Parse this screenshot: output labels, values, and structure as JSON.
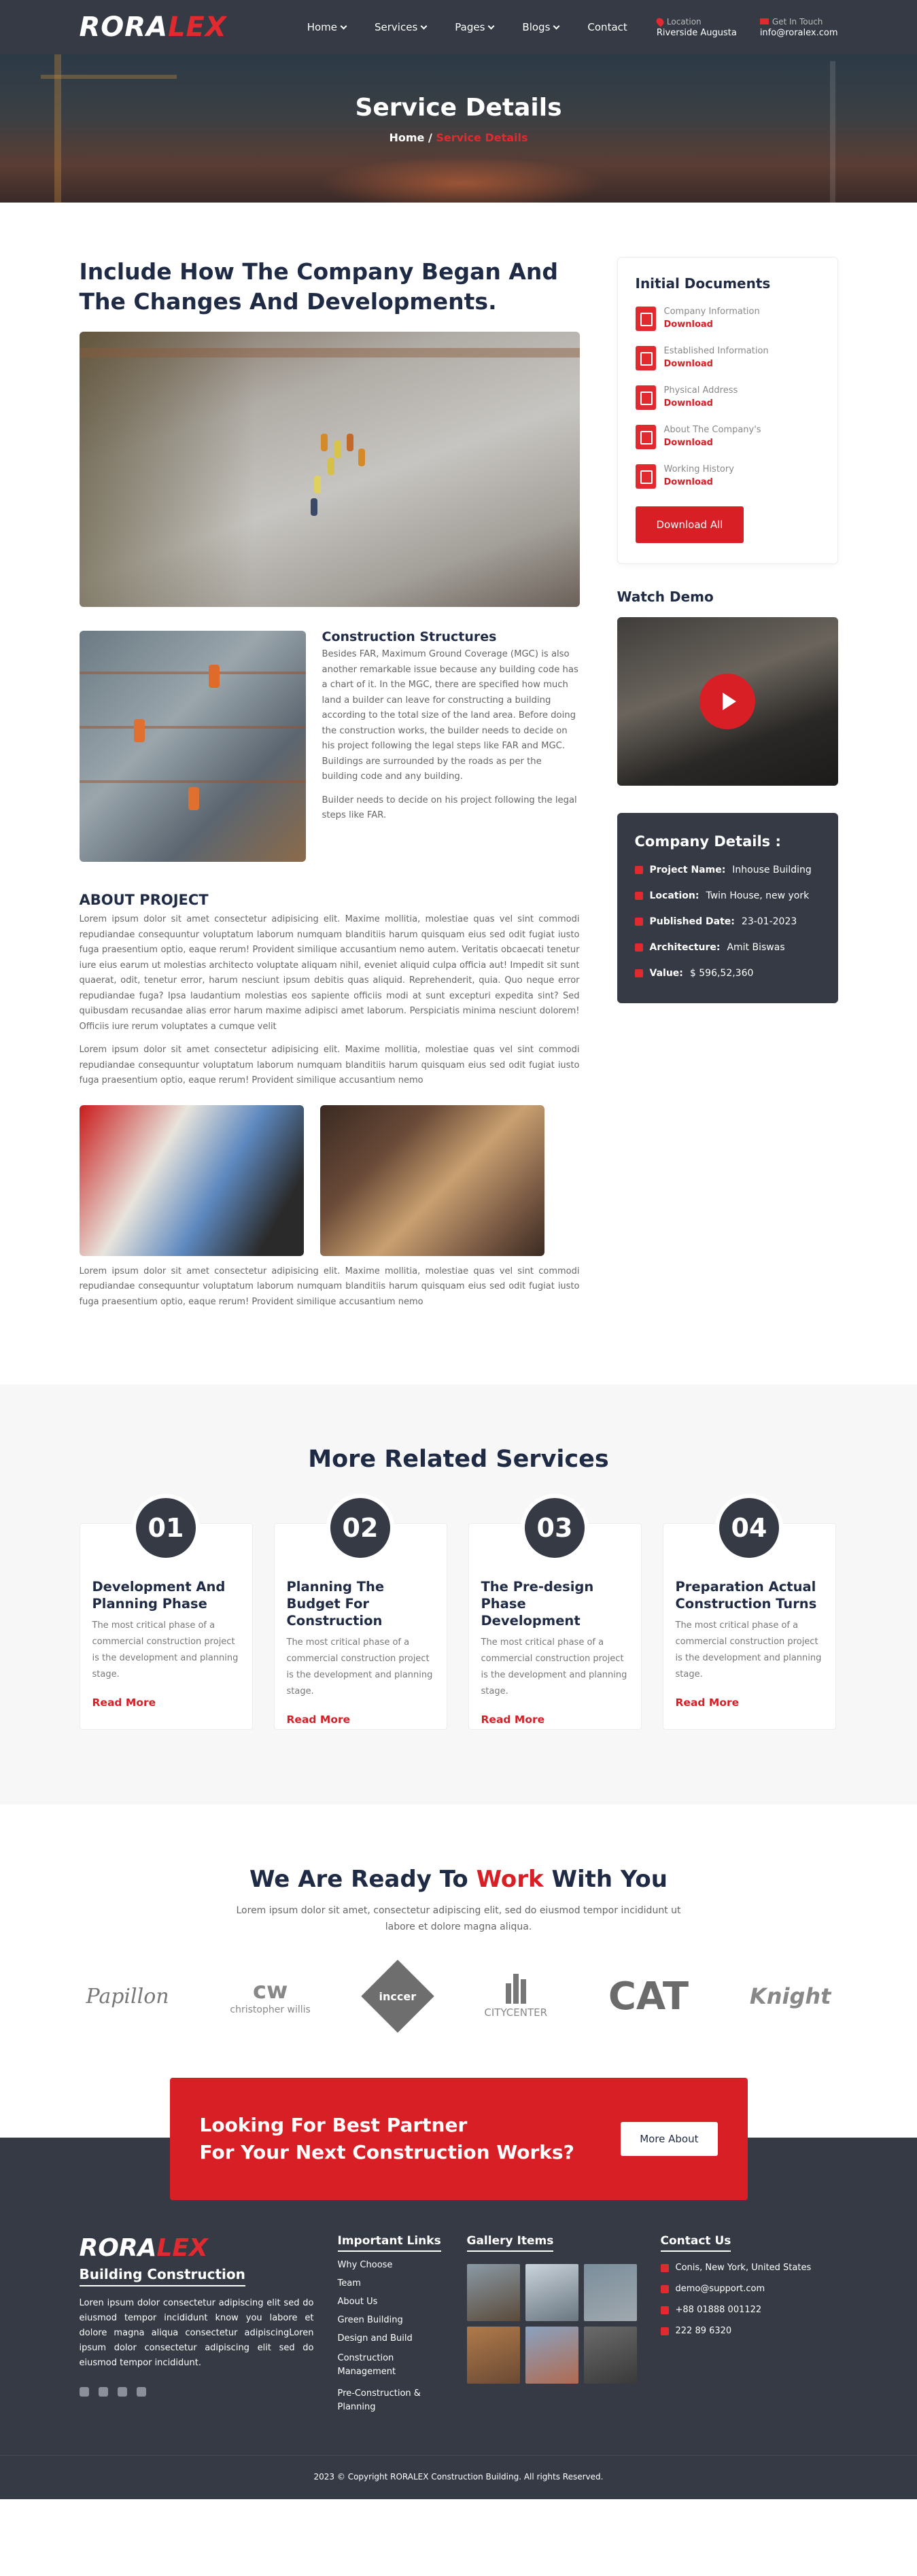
{
  "header": {
    "logo_a": "RORA",
    "logo_b": "LEX",
    "nav": [
      {
        "label": "Home",
        "dropdown": true
      },
      {
        "label": "Services",
        "dropdown": true
      },
      {
        "label": "Pages",
        "dropdown": true
      },
      {
        "label": "Blogs",
        "dropdown": true
      },
      {
        "label": "Contact",
        "dropdown": false
      }
    ],
    "location_label": "Location",
    "location_value": "Riverside Augusta",
    "touch_label": "Get In Touch",
    "touch_value": "info@roralex.com"
  },
  "banner": {
    "title": "Service Details",
    "crumb_home": "Home",
    "crumb_sep": " / ",
    "crumb_current": "Service Details"
  },
  "main": {
    "heading": "Include How The Company Began And The Changes And Developments.",
    "cs_title": "Construction Structures",
    "cs_p1": "Besides FAR, Maximum Ground Coverage (MGC) is also another remarkable issue because any building code has a chart of it. In the MGC, there are specified how much land a builder can leave for constructing a building according to the total size of the land area. Before doing the construction works, the builder needs to decide on his project following the legal steps like FAR and MGC. Buildings are surrounded by the roads as per the building code and any building.",
    "cs_p2": "Builder needs to decide on his project following the legal steps like FAR.",
    "about_title": "ABOUT PROJECT",
    "about_p1": "Lorem ipsum dolor sit amet consectetur adipisicing elit. Maxime mollitia, molestiae quas vel sint commodi repudiandae consequuntur voluptatum laborum numquam blanditiis harum quisquam eius sed odit fugiat iusto fuga praesentium optio, eaque rerum! Provident similique accusantium nemo autem. Veritatis obcaecati tenetur iure eius earum ut molestias architecto voluptate aliquam nihil, eveniet aliquid culpa officia aut! Impedit sit sunt quaerat, odit, tenetur error, harum nesciunt ipsum debitis quas aliquid. Reprehenderit, quia. Quo neque error repudiandae fuga? Ipsa laudantium molestias eos sapiente officiis modi at sunt excepturi expedita sint? Sed quibusdam recusandae alias error harum maxime adipisci amet laborum. Perspiciatis minima nesciunt dolorem! Officiis iure rerum voluptates a cumque velit",
    "about_p2": "Lorem ipsum dolor sit amet consectetur adipisicing elit. Maxime mollitia, molestiae quas vel sint commodi repudiandae consequuntur voluptatum laborum numquam blanditiis harum quisquam eius sed odit fugiat iusto fuga praesentium optio, eaque rerum! Provident similique accusantium nemo",
    "about_p3": "Lorem ipsum dolor sit amet consectetur adipisicing elit. Maxime mollitia, molestiae quas vel sint commodi repudiandae consequuntur voluptatum laborum numquam blanditiis harum quisquam eius sed odit fugiat iusto fuga praesentium optio, eaque rerum! Provident similique accusantium nemo"
  },
  "sidebar": {
    "docs_title": "Initial Documents",
    "docs": [
      {
        "title": "Company Information",
        "link": "Download"
      },
      {
        "title": "Established Information",
        "link": "Download"
      },
      {
        "title": "Physical Address",
        "link": "Download"
      },
      {
        "title": "About The Company's",
        "link": "Download"
      },
      {
        "title": "Working History",
        "link": "Download"
      }
    ],
    "download_all": "Download All",
    "watch_title": "Watch Demo",
    "company_title": "Company Details :",
    "company": [
      {
        "k": "Project Name:",
        "v": "Inhouse Building"
      },
      {
        "k": "Location:",
        "v": "Twin House, new york"
      },
      {
        "k": "Published Date:",
        "v": "23-01-2023"
      },
      {
        "k": "Architecture:",
        "v": "Amit Biswas"
      },
      {
        "k": "Value:",
        "v": "$ 596,52,360"
      }
    ]
  },
  "services": {
    "title": "More Related Services",
    "items": [
      {
        "num": "01",
        "title": "Development And Planning Phase",
        "text": "The most critical phase of a commercial construction project is the development and planning stage.",
        "link": "Read More"
      },
      {
        "num": "02",
        "title": "Planning The Budget For Construction",
        "text": "The most critical phase of a commercial construction project is the development and planning stage.",
        "link": "Read More"
      },
      {
        "num": "03",
        "title": "The Pre-design Phase Development",
        "text": "The most critical phase of a commercial construction project is the development and planning stage.",
        "link": "Read More"
      },
      {
        "num": "04",
        "title": "Preparation Actual Construction Turns",
        "text": "The most critical phase of a commercial construction project is the development and planning stage.",
        "link": "Read More"
      }
    ]
  },
  "ready": {
    "title_a": "We Are Ready To ",
    "title_b": "Work",
    "title_c": " With You",
    "sub": "Lorem ipsum dolor sit amet, consectetur adipiscing elit, sed do eiusmod tempor incididunt ut labore et dolore magna aliqua.",
    "logos": [
      "Papillon",
      "christopher willis",
      "inccer",
      "CITYCENTER",
      "CAT",
      "Knight"
    ]
  },
  "cta": {
    "line1": "Looking For Best Partner",
    "line2": "For Your Next Construction Works?",
    "button": "More About"
  },
  "footer": {
    "logo_a": "RORA",
    "logo_b": "LEX",
    "tagline": "Building Construction",
    "about": "Loren ipsum dolor consectetur adipiscing elit sed do eiusmod tempor incididunt know you labore et dolore magna aliqua consectetur adipiscingLoren ipsum dolor consectetur adipiscing elit sed do eiusmod tempor incididunt.",
    "links_title": "Important Links",
    "links": [
      "Why Choose",
      "Team",
      "About Us",
      "Green Building",
      "Design and Build",
      "Construction Management",
      "Pre-Construction & Planning"
    ],
    "gallery_title": "Gallery Items",
    "contact_title": "Contact Us",
    "contacts": [
      "Conis, New York, United States",
      "demo@support.com",
      "+88 01888 001122",
      "222 89 6320"
    ],
    "copyright": "2023 © Copyright RORALEX Construction Building. All rights Reserved."
  }
}
